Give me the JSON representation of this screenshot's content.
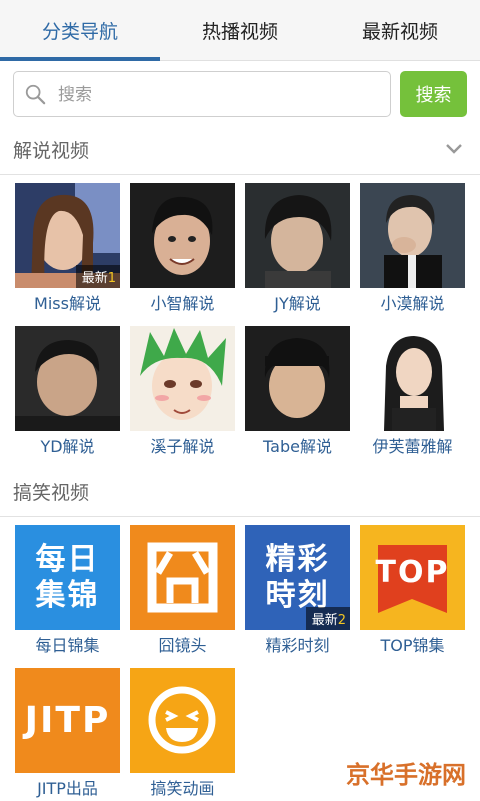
{
  "tabs": [
    {
      "label": "分类导航",
      "active": true
    },
    {
      "label": "热播视频",
      "active": false
    },
    {
      "label": "最新视频",
      "active": false
    }
  ],
  "search": {
    "placeholder": "搜索",
    "button_label": "搜索"
  },
  "sections": {
    "commentary": {
      "title": "解说视频",
      "items": [
        {
          "label": "Miss解说",
          "badge_text": "最新",
          "badge_count": "1"
        },
        {
          "label": "小智解说"
        },
        {
          "label": "JY解说"
        },
        {
          "label": "小漠解说"
        },
        {
          "label": "YD解说"
        },
        {
          "label": "溪子解说"
        },
        {
          "label": "Tabe解说"
        },
        {
          "label": "伊芙蕾雅解"
        }
      ]
    },
    "funny": {
      "title": "搞笑视频",
      "items": [
        {
          "label": "每日锦集",
          "tile_text": "每日\n集锦",
          "color": "#2a8fe0"
        },
        {
          "label": "囧镜头",
          "tile_text": "",
          "color": "#f08a1c"
        },
        {
          "label": "精彩时刻",
          "tile_text": "精彩\n時刻",
          "color": "#2f63b8",
          "badge_text": "最新",
          "badge_count": "2"
        },
        {
          "label": "TOP锦集",
          "tile_text": "TOP",
          "color": "#f6b51f"
        },
        {
          "label": "JITP出品",
          "tile_text": "JITP",
          "color": "#f08a1c"
        },
        {
          "label": "搞笑动画",
          "tile_text": "",
          "color": "#f6a515"
        }
      ]
    }
  },
  "watermark": "京华手游网",
  "colors": {
    "accent": "#2f6aa6",
    "search_button": "#75c13b",
    "caption": "#2f5f94"
  }
}
